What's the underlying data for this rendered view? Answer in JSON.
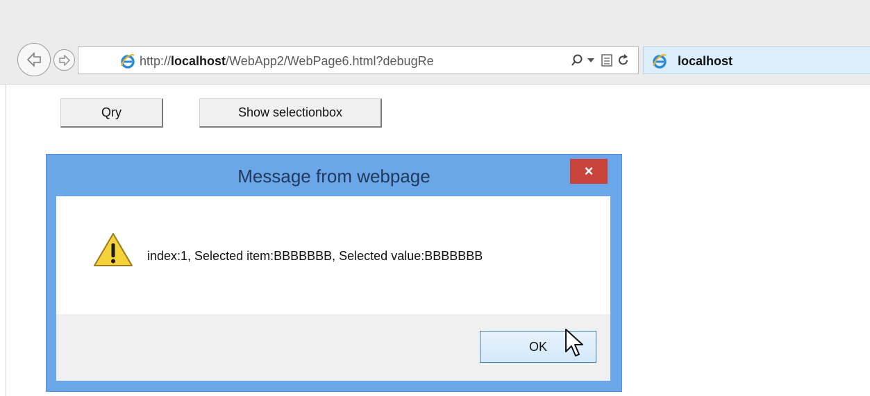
{
  "browser": {
    "address": {
      "protocol": "http://",
      "host": "localhost",
      "path": "/WebApp2/WebPage6.html?debugRe"
    },
    "address_icons": [
      "ie-logo-icon",
      "search-icon",
      "dropdown-arrow-icon",
      "compatibility-view-icon",
      "refresh-icon"
    ],
    "tab": {
      "label": "localhost"
    }
  },
  "page": {
    "buttons": {
      "qry": "Qry",
      "show_selectionbox": "Show selectionbox"
    }
  },
  "dialog": {
    "title": "Message from webpage",
    "close_glyph": "×",
    "message": "index:1, Selected item:BBBBBBB, Selected value:BBBBBBB",
    "ok_label": "OK",
    "icon": "warning-icon"
  },
  "colors": {
    "dialog_frame": "#6aa6e8",
    "close_button": "#c9443c",
    "tab_background": "#dceefb",
    "ie_logo": "#2a8ad6"
  }
}
